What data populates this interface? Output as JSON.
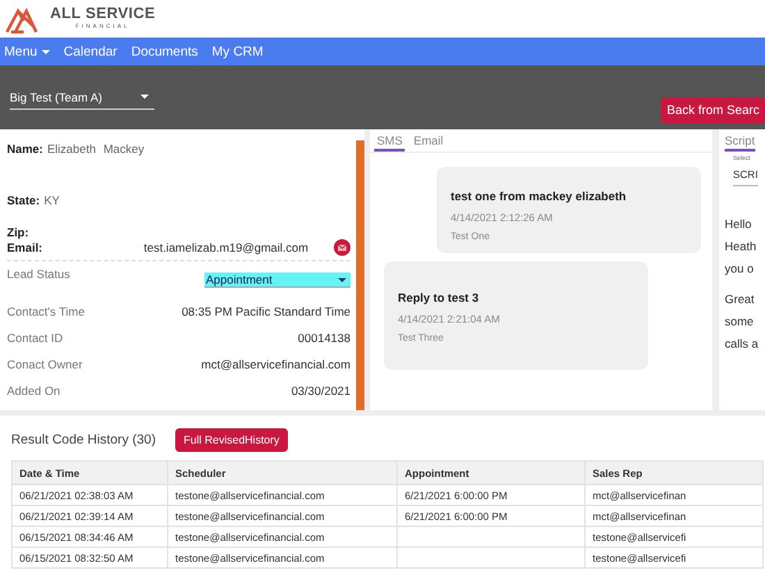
{
  "brand": {
    "name": "ALL SERVICE",
    "tagline": "FINANCIAL"
  },
  "nav": [
    {
      "label": "Menu",
      "kind": "dropdown"
    },
    {
      "label": "Calendar",
      "kind": "link"
    },
    {
      "label": "Documents",
      "kind": "link"
    },
    {
      "label": "My CRM",
      "kind": "link"
    }
  ],
  "toolbar": {
    "team_select": {
      "value": "Big Test (Team A)"
    },
    "back_button": "Back from Searc"
  },
  "lead": {
    "fields": [
      {
        "label": "Name:",
        "value": "Elizabeth Mackey"
      },
      {
        "label": "State:",
        "value": "KY"
      },
      {
        "label": "Zip:"
      },
      {
        "label": "Email:",
        "value": "test.iamelizab.m19@gmail.com"
      }
    ],
    "lead_status": {
      "label": "Lead Status",
      "value": "Appointment"
    },
    "details": [
      {
        "label": "Contact's Time",
        "value": "08:35 PM Pacific Standard Time"
      },
      {
        "label": "Contact ID",
        "value": "00014138"
      },
      {
        "label": "Conact Owner",
        "value": "mct@allservicefinancial.com"
      },
      {
        "label": "Added On",
        "value": "03/30/2021"
      }
    ]
  },
  "messages": {
    "tabs": [
      {
        "label": "SMS",
        "selected": true
      },
      {
        "label": "Email",
        "selected": false
      }
    ],
    "items": [
      {
        "kind": "sent",
        "text": "test one from mackey elizabeth",
        "time": "4/14/2021 2:12:26 AM",
        "sender": "Test One"
      },
      {
        "kind": "received",
        "text": "Reply to test 3",
        "time": "4/14/2021 2:21:04 AM",
        "sender": "Test Three"
      }
    ]
  },
  "script": {
    "tabs": [
      {
        "label": "Script",
        "selected": true
      }
    ],
    "select": {
      "label": "Select",
      "value": "SCRI"
    },
    "paragraphs": [
      [
        "Hello",
        "Heath",
        "you o"
      ],
      [
        "Great",
        "some",
        "calls a"
      ]
    ]
  },
  "history": {
    "title": "Result Code History (30)",
    "button": "Full RevisedHistory",
    "columns": [
      "Date & Time",
      "Scheduler",
      "Appointment",
      "Sales Rep"
    ],
    "rows": [
      [
        "06/21/2021 02:38:03 AM",
        "testone@allservicefinancial.com",
        "6/21/2021 6:00:00 PM",
        "mct@allservicefinan"
      ],
      [
        "06/21/2021 02:39:14 AM",
        "testone@allservicefinancial.com",
        "6/21/2021 6:00:00 PM",
        "mct@allservicefinan"
      ],
      [
        "06/15/2021 08:34:46 AM",
        "testone@allservicefinancial.com",
        "",
        "testone@allservicefi"
      ],
      [
        "06/15/2021 08:32:50 AM",
        "testone@allservicefinancial.com",
        "",
        "testone@allservicefi"
      ]
    ]
  }
}
